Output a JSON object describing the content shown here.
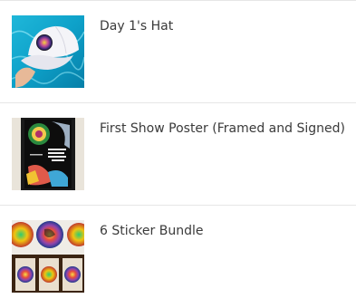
{
  "products": [
    {
      "title": "Day 1's Hat",
      "image_icon": "hat-photo"
    },
    {
      "title": "First Show Poster (Framed and Signed)",
      "image_icon": "framed-poster-photo"
    },
    {
      "title": "6 Sticker Bundle",
      "image_icon": "sticker-sheet-photo"
    }
  ],
  "colors": {
    "text": "#3a3a3a",
    "divider": "#e6e6e6",
    "background": "#ffffff"
  }
}
